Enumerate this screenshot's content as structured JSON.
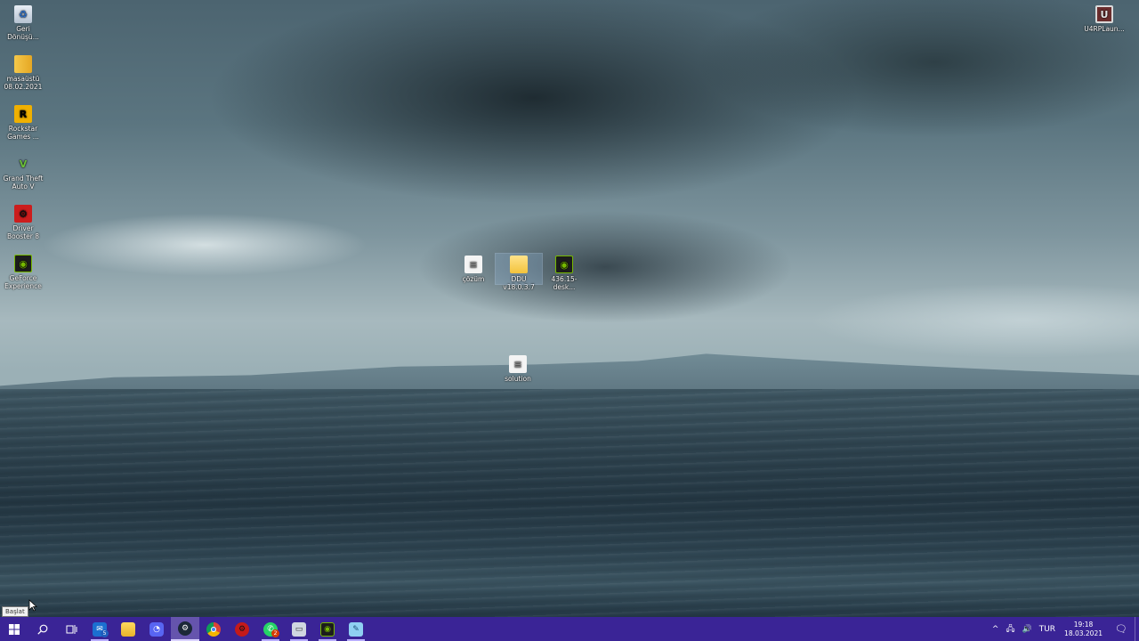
{
  "desktop_icons": {
    "recycle_bin": "Geri Dönüşü...",
    "masaustu": "masaüstü 08.02.2021",
    "rockstar": "Rockstar Games ...",
    "gta": "Grand Theft Auto V",
    "driver_booster": "Driver Booster 8",
    "geforce": "GeForce Experience",
    "cozum": "çözüm",
    "ddu": "DDU v18.0.3.7",
    "nvidia_driver": "436.15-desk...",
    "solution": "solution",
    "u4arp": "U4RPLaun..."
  },
  "tooltip": "Başlat",
  "taskbar": {
    "mail_badge": "5",
    "whatsapp_badge": "2"
  },
  "tray": {
    "language": "TUR",
    "time": "19:18",
    "date": "18.03.2021"
  },
  "colors": {
    "taskbar": "#3a2496",
    "active_indicator": "#d9d2ff"
  }
}
